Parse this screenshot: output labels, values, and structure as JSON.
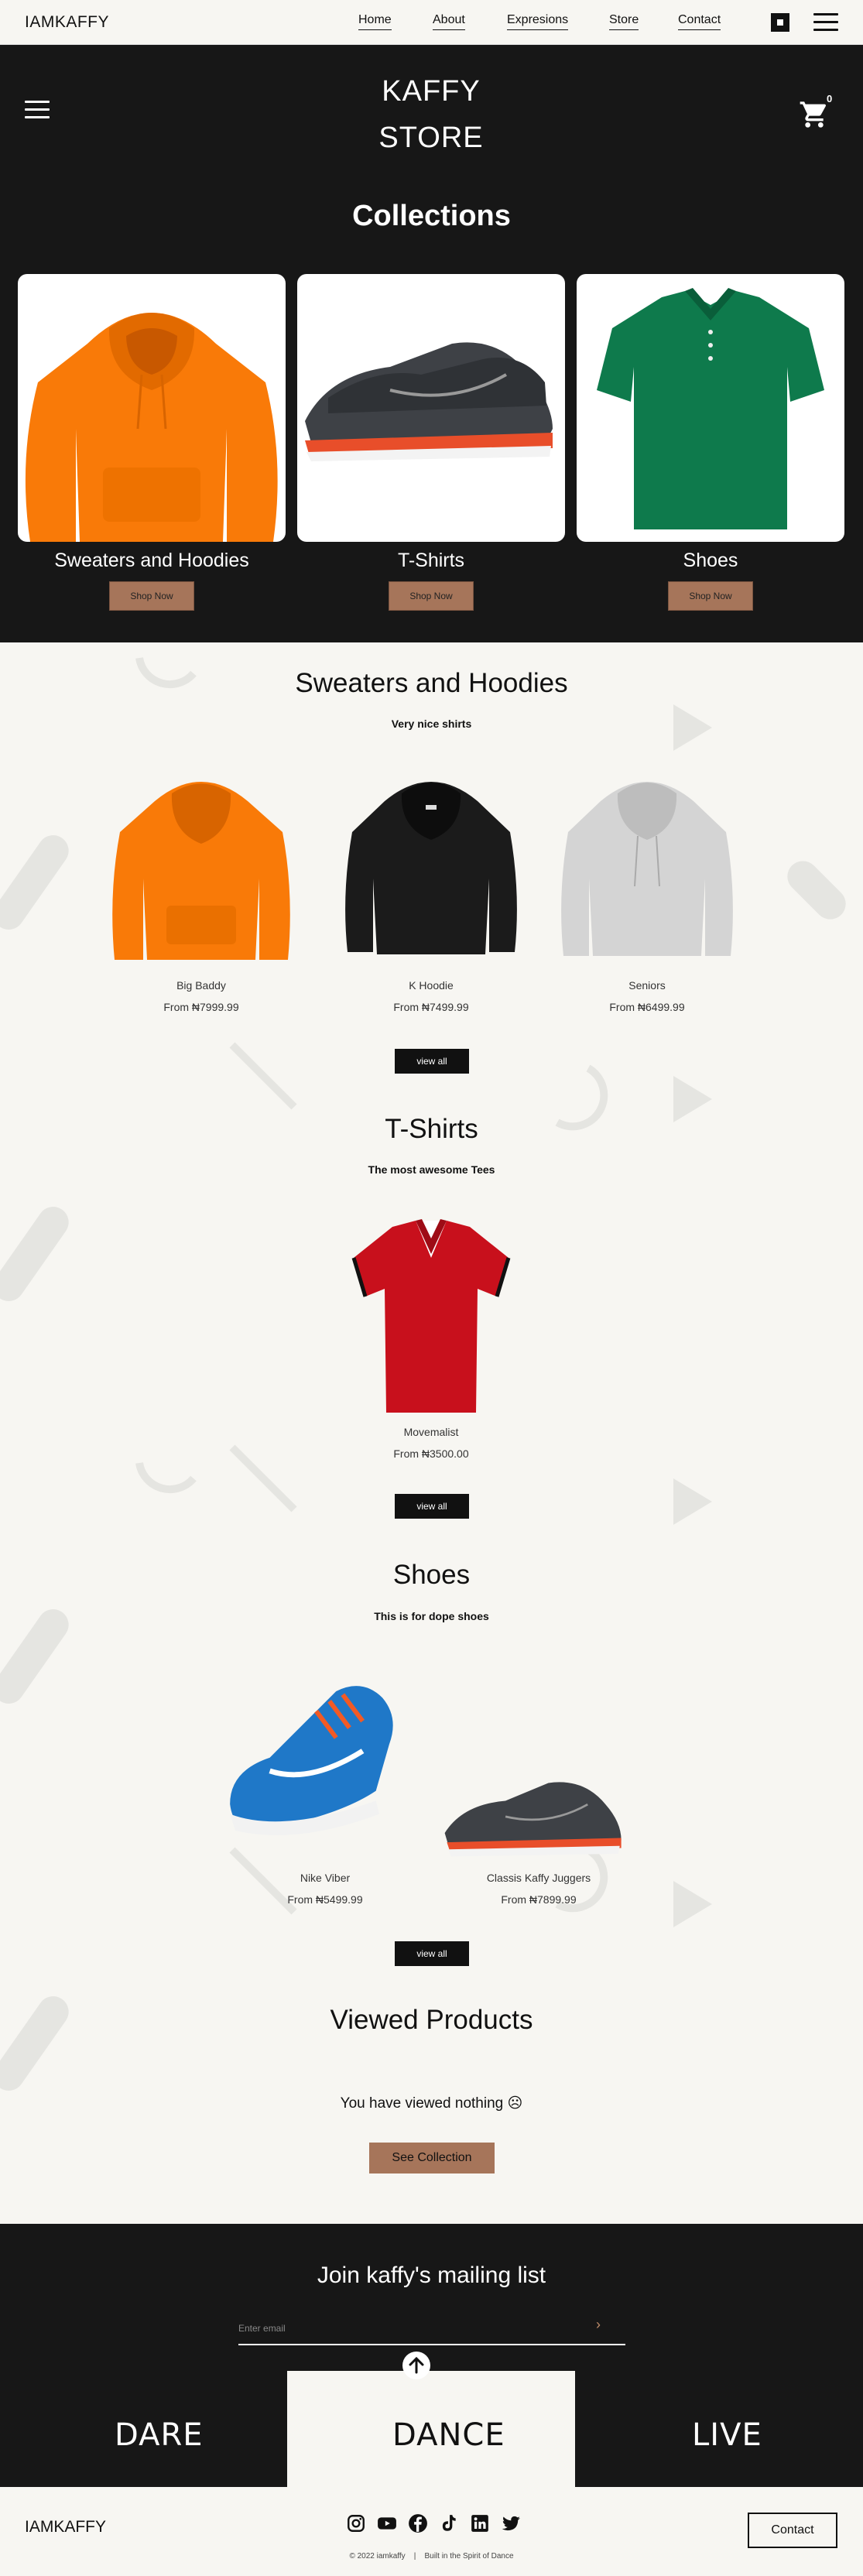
{
  "nav": {
    "brand": "IAMKAFFY",
    "links": [
      "Home",
      "About",
      "Expresions",
      "Store",
      "Contact"
    ]
  },
  "hero": {
    "title_line1": "KAFFY",
    "title_line2": "STORE",
    "cart_count": "0"
  },
  "collections": {
    "title": "Collections",
    "items": [
      {
        "name": "Sweaters and Hoodies",
        "button": "Shop Now"
      },
      {
        "name": "T-Shirts",
        "button": "Shop Now"
      },
      {
        "name": "Shoes",
        "button": "Shop Now"
      }
    ]
  },
  "sweaters": {
    "title": "Sweaters and Hoodies",
    "subtitle": "Very nice shirts",
    "products": [
      {
        "name": "Big Baddy",
        "price": "From ₦7999.99"
      },
      {
        "name": "K Hoodie",
        "price": "From ₦7499.99"
      },
      {
        "name": "Seniors",
        "price": "From ₦6499.99"
      }
    ],
    "view_all": "view all"
  },
  "tshirts": {
    "title": "T-Shirts",
    "subtitle": "The most awesome Tees",
    "products": [
      {
        "name": "Movemalist",
        "price": "From ₦3500.00"
      }
    ],
    "view_all": "view all"
  },
  "shoes": {
    "title": "Shoes",
    "subtitle": "This is for dope shoes",
    "products": [
      {
        "name": "Nike Viber",
        "price": "From ₦5499.99"
      },
      {
        "name": "Classis Kaffy Juggers",
        "price": "From ₦7899.99"
      }
    ],
    "view_all": "view all"
  },
  "viewed": {
    "title": "Viewed Products",
    "message": "You have viewed nothing ☹",
    "button": "See Collection"
  },
  "mailing": {
    "title": "Join kaffy's mailing list",
    "placeholder": "Enter email",
    "submit": "›",
    "words": [
      "DARE",
      "DANCE",
      "LIVE"
    ]
  },
  "footer": {
    "brand": "IAMKAFFY",
    "copyright": "© 2022 iamkaffy    |    Built in the Spirit of Dance",
    "contact": "Contact",
    "social_icons": [
      "instagram-icon",
      "youtube-icon",
      "facebook-icon",
      "tiktok-icon",
      "linkedin-icon",
      "twitter-icon"
    ]
  },
  "colors": {
    "dark": "#171717",
    "accent": "#a6755a",
    "background": "#f7f6f2"
  }
}
